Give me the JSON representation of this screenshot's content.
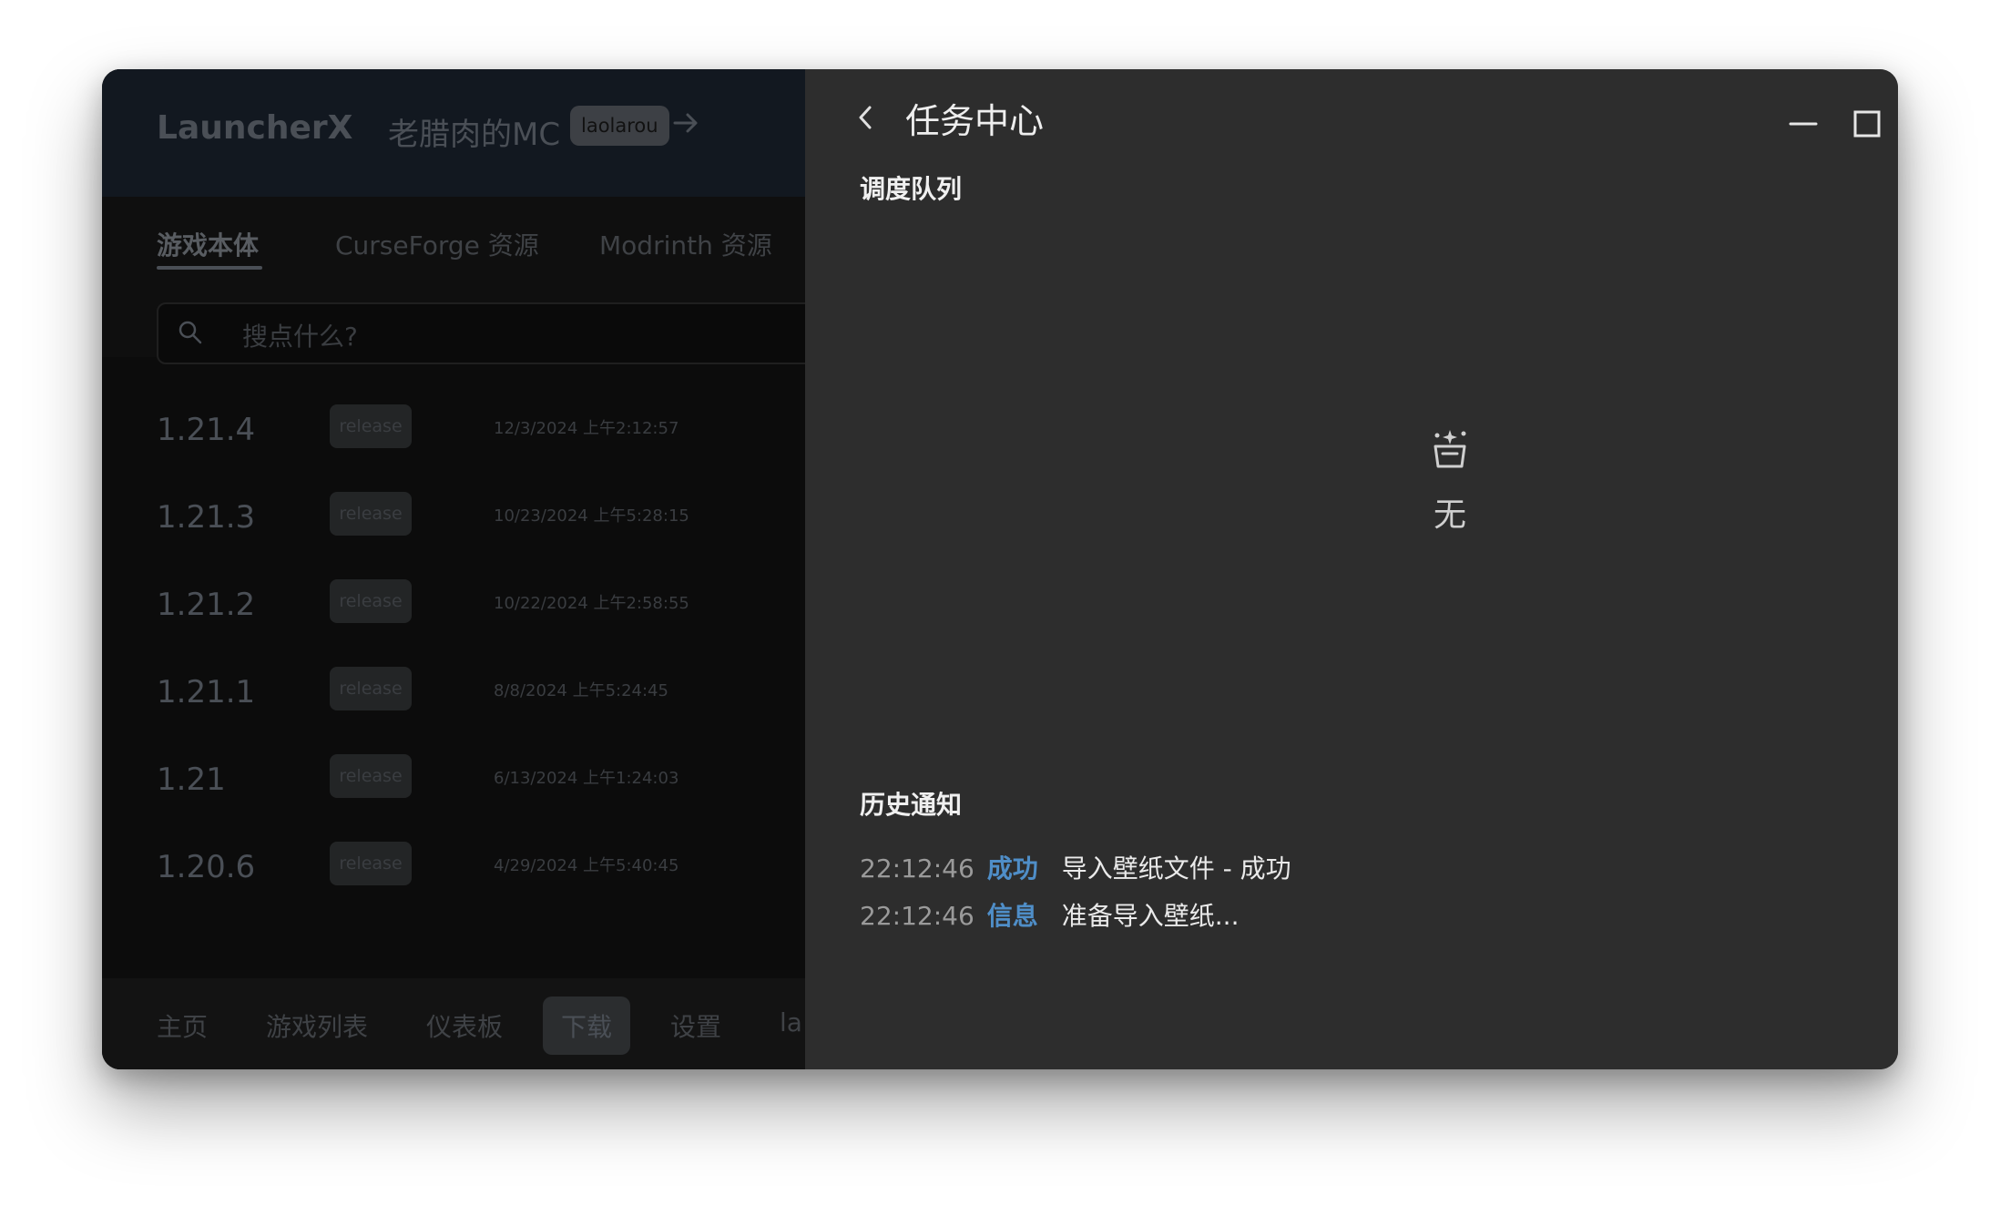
{
  "launcher": {
    "brand": "LauncherX",
    "profile_name": "老腊肉的MC",
    "profile_badge": "laolarou",
    "subtabs": [
      "游戏本体",
      "CurseForge 资源",
      "Modrinth 资源"
    ],
    "search_placeholder": "搜点什么?",
    "versions": [
      {
        "name": "1.21.4",
        "type": "release",
        "date": "12/3/2024 上午2:12:57"
      },
      {
        "name": "1.21.3",
        "type": "release",
        "date": "10/23/2024 上午5:28:15"
      },
      {
        "name": "1.21.2",
        "type": "release",
        "date": "10/22/2024 上午2:58:55"
      },
      {
        "name": "1.21.1",
        "type": "release",
        "date": "8/8/2024 上午5:24:45"
      },
      {
        "name": "1.21",
        "type": "release",
        "date": "6/13/2024 上午1:24:03"
      },
      {
        "name": "1.20.6",
        "type": "release",
        "date": "4/29/2024 上午5:40:45"
      }
    ],
    "bottom_nav": [
      "主页",
      "游戏列表",
      "仪表板",
      "下载",
      "设置",
      "la"
    ]
  },
  "task_center": {
    "title": "任务中心",
    "queue_title": "调度队列",
    "queue_empty_text": "无",
    "history_title": "历史通知",
    "history": [
      {
        "time": "22:12:46",
        "level": "成功",
        "message": "导入壁纸文件 - 成功"
      },
      {
        "time": "22:12:46",
        "level": "信息",
        "message": "准备导入壁纸..."
      }
    ]
  },
  "colors": {
    "accent_blue": "#4f8ec8",
    "panel_bg": "#2d2d2d",
    "left_bg": "#0c0c0c"
  }
}
